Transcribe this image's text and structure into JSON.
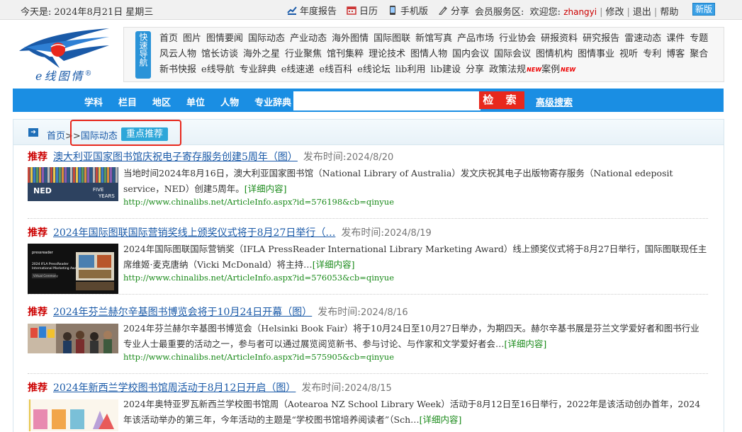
{
  "topbar": {
    "date_label": "今天是:",
    "date": "2024年8月21日",
    "weekday": "星期三",
    "tools": [
      {
        "icon": "report-icon",
        "label": "年度报告"
      },
      {
        "icon": "calendar-icon",
        "label": "日历"
      },
      {
        "icon": "phone-icon",
        "label": "手机版"
      },
      {
        "icon": "share-icon",
        "label": "分享"
      }
    ],
    "member_label": "会员服务区:",
    "welcome": "欢迎您:",
    "username": "zhangyi",
    "edit": "修改",
    "logout": "退出",
    "help": "帮助",
    "new_version": "新版"
  },
  "logo": {
    "text": "e线图情",
    "reg": "®"
  },
  "quicknav": {
    "label": "快速导航",
    "links": [
      "首页",
      "图片",
      "图情要闻",
      "国际动态",
      "产业动态",
      "海外图情",
      "国际图联",
      "新馆写真",
      "产品市场",
      "行业协会",
      "研报资料",
      "研究报告",
      "雷速动态",
      "课件",
      "专题",
      "风云人物",
      "馆长访谈",
      "海外之星",
      "行业聚焦",
      "馆刊集粹",
      "理论技术",
      "图情人物",
      "国内会议",
      "国际会议",
      "图情机构",
      "图情事业",
      "视听",
      "专利",
      "博客",
      "聚合",
      "新书快报",
      "e线导航",
      "专业辞典",
      "e线速递",
      "e线百科",
      "e线论坛",
      "lib利用",
      "lib建设",
      "分享",
      "政策法规",
      "案例"
    ],
    "new_badge": "NEW"
  },
  "search": {
    "categories": [
      "学科",
      "栏目",
      "地区",
      "单位",
      "人物",
      "专业辞典"
    ],
    "placeholder": "",
    "button": "检 索",
    "advanced": "高级搜索"
  },
  "breadcrumb": {
    "home": "首页",
    "sep": ">>",
    "section": "国际动态",
    "tag": "重点推荐"
  },
  "articles": [
    {
      "badge": "推荐",
      "title": "澳大利亚国家图书馆庆祝电子寄存服务创建5周年（图）",
      "pub_label": "发布时间:",
      "pub_date": "2024/8/20",
      "summary": "当地时间2024年8月16日，澳大利亚国家图书馆（National Library of Australia）发文庆祝其电子出版物寄存服务（National edeposit service，NED）创建5周年。",
      "more": "[详细内容]",
      "url": "http://www.chinalibs.net/ArticleInfo.aspx?id=576198&cb=qinyue"
    },
    {
      "badge": "推荐",
      "title": "2024年国际图联国际营销奖线上颁奖仪式将于8月27日举行（…",
      "pub_label": "发布时间:",
      "pub_date": "2024/8/19",
      "summary": "2024年国际图联国际营销奖（IFLA PressReader International Library Marketing Award）线上颁奖仪式将于8月27日举行，国际图联现任主席维姬·麦克唐纳（Vicki McDonald）将主持…",
      "more": "[详细内容]",
      "url": "http://www.chinalibs.net/ArticleInfo.aspx?id=576053&cb=qinyue"
    },
    {
      "badge": "推荐",
      "title": "2024年芬兰赫尔辛基图书博览会将于10月24日开幕（图）",
      "pub_label": "发布时间:",
      "pub_date": "2024/8/16",
      "summary": "2024年芬兰赫尔辛基图书博览会（Helsinki Book Fair）将于10月24日至10月27日举办，为期四天。赫尔辛基书展是芬兰文学爱好者和图书行业专业人士最重要的活动之一，参与者可以通过展览阅览新书、参与讨论、与作家和文学爱好者会…",
      "more": "[详细内容]",
      "url": "http://www.chinalibs.net/ArticleInfo.aspx?id=575905&cb=qinyue"
    },
    {
      "badge": "推荐",
      "title": "2024年新西兰学校图书馆周活动于8月12日开启（图）",
      "pub_label": "发布时间:",
      "pub_date": "2024/8/15",
      "summary": "2024年奥特亚罗瓦新西兰学校图书馆周（Aotearoa NZ School Library Week）活动于8月12日至16日举行，2022年是该活动创办首年，2024年该活动举办的第三年，今年活动的主题是“学校图书馆培养阅读者”（Sch…",
      "more": "[详细内容]",
      "url": ""
    }
  ],
  "thumb_text": {
    "ned": "NED",
    "five": "FIVE",
    "years": "YEARS",
    "pressreader": "pressreader",
    "award_line1": "2024 IFLA PressReader",
    "award_line2": "International Marketing Award",
    "virtual": "Virtual Ceremony"
  }
}
